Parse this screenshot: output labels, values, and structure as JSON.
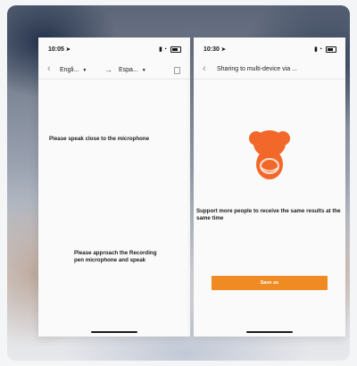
{
  "left_phone": {
    "time": "10:05",
    "source_language": "Engli...",
    "target_language": "Espa...",
    "message_top": "Please speak close to the microphone",
    "message_bottom": "Please approach the Recording pen microphone and speak"
  },
  "right_phone": {
    "time": "10:30",
    "title": "Sharing to multi-device via ...",
    "message": "Support more people to receive the same results at the same time",
    "button_label": "Save as",
    "accent_color": "#f08a22"
  },
  "icons": {
    "location": "location-arrow-icon",
    "signal": "signal-icon",
    "wifi": "wifi-icon",
    "battery": "battery-icon",
    "back": "back-chevron-icon",
    "swap": "arrow-right-icon",
    "copy": "copy-icon",
    "mascot": "mascot-headphones-icon"
  }
}
